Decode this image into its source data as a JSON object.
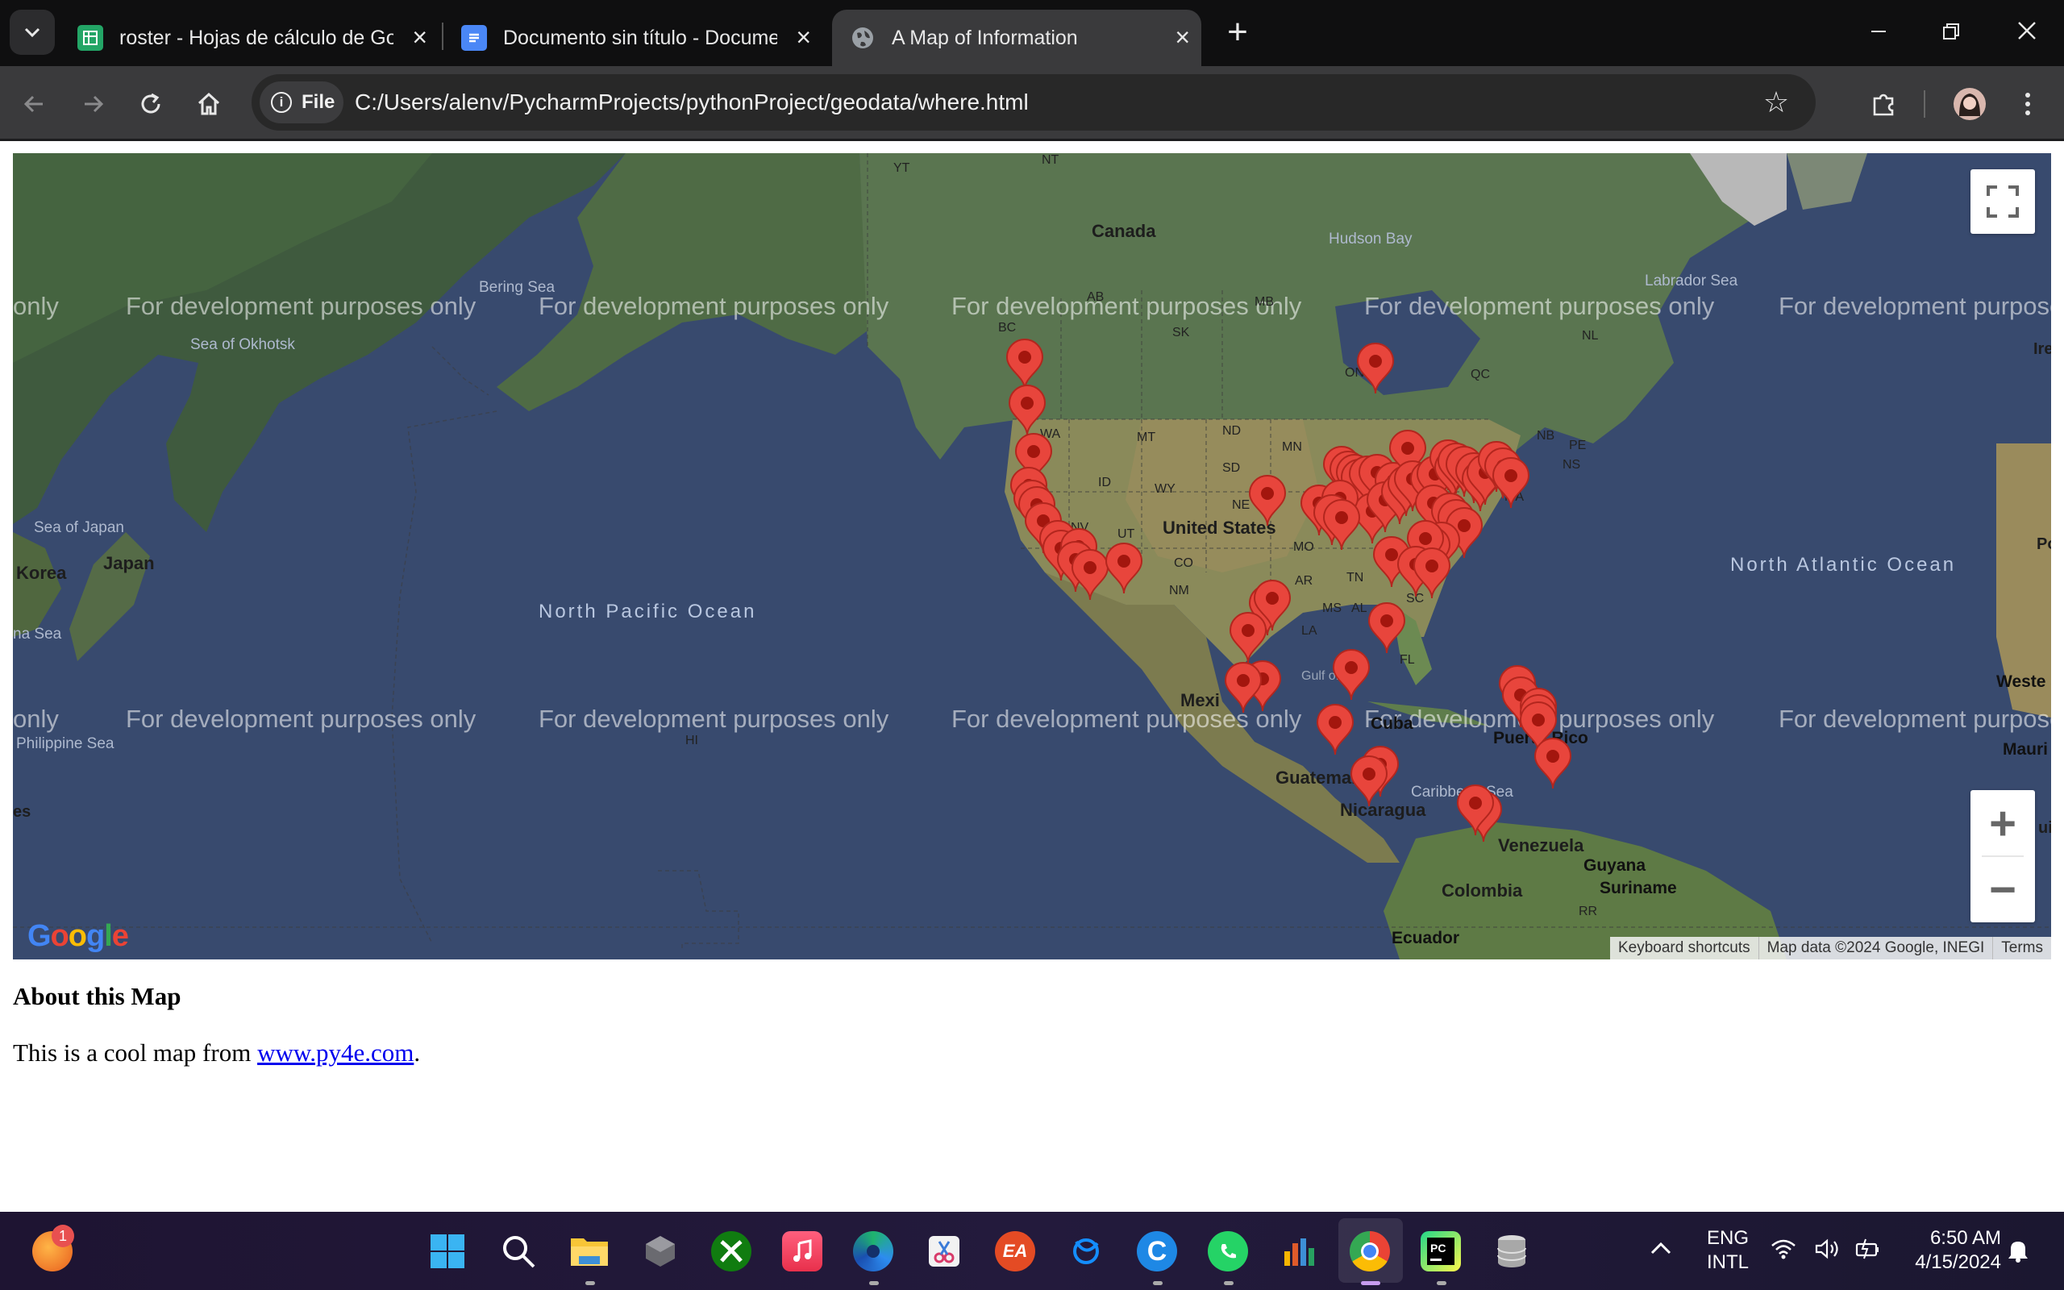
{
  "browser": {
    "tabs": [
      {
        "title": "roster - Hojas de cálculo de Goo",
        "favicon": "sheets-icon",
        "color": "#23a566"
      },
      {
        "title": "Documento sin título - Docume",
        "favicon": "docs-icon",
        "color": "#4a87f6"
      },
      {
        "title": "A Map of Information",
        "favicon": "globe-icon",
        "color": "#9aa0a6"
      }
    ],
    "security_chip": "File",
    "url": "C:/Users/alenv/PycharmProjects/pythonProject/geodata/where.html"
  },
  "map": {
    "watermark": "For development purposes only",
    "watermark_edge": "only",
    "watermark_cut": "For development purpose",
    "countries": [
      "Canada",
      "United States",
      "Mexi",
      "Guatemala",
      "Nicaragua",
      "Venezuela",
      "Colombia",
      "Guyana",
      "Suriname",
      "Ecuador",
      "Puerto Rico",
      "Cuba",
      "Korea",
      "Japan",
      "Weste Sahar",
      "Mauri"
    ],
    "regions": [
      "YT",
      "NT",
      "BC",
      "AB",
      "SK",
      "MB",
      "ON",
      "QC",
      "NL",
      "NB",
      "PE",
      "NS",
      "WA",
      "MT",
      "ND",
      "MN",
      "SD",
      "ID",
      "WY",
      "NE",
      "NV",
      "UT",
      "CO",
      "MO",
      "AR",
      "NM",
      "TN",
      "NC",
      "SC",
      "MS",
      "AL",
      "GA",
      "LA",
      "FL",
      "MA",
      "HI",
      "RR",
      "Ire",
      "Gulf of Me"
    ],
    "seas": [
      "Hudson Bay",
      "Labrador Sea",
      "Bering Sea",
      "Sea of Okhotsk",
      "Sea of Japan",
      "Philippine Sea",
      "Caribbean Sea",
      "na Sea",
      "es",
      "Po",
      "ui"
    ],
    "oceans": [
      "North Pacific Ocean",
      "North Atlantic Ocean"
    ],
    "google_logo": "Google",
    "attribution": [
      "Keyboard shortcuts",
      "Map data ©2024 Google, INEGI",
      "Terms"
    ],
    "marker_color": "#e8453c"
  },
  "page": {
    "heading": "About this Map",
    "text_before": "This is a cool map from ",
    "link_text": "www.py4e.com",
    "text_after": "."
  },
  "taskbar": {
    "notification_badge": "1",
    "lang_line1": "ENG",
    "lang_line2": "INTL",
    "time": "6:50 AM",
    "date": "4/15/2024"
  }
}
